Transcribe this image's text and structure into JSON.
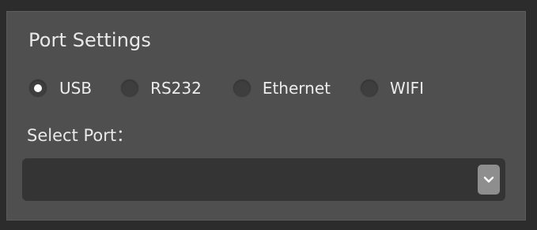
{
  "port_settings": {
    "title": "Port Settings",
    "connection_types": [
      {
        "label": "USB",
        "checked": true
      },
      {
        "label": "RS232",
        "checked": false
      },
      {
        "label": "Ethernet",
        "checked": false
      },
      {
        "label": "WIFI",
        "checked": false
      }
    ],
    "select_port": {
      "label": "Select Port：",
      "value": "",
      "arrow_icon": "chevron-down-icon"
    }
  },
  "colors": {
    "background": "#2c2c2c",
    "panel": "#4f4f4f",
    "select_box": "#343434",
    "arrow_button": "#8e8e8e",
    "radio_dot": "#ffffff"
  }
}
